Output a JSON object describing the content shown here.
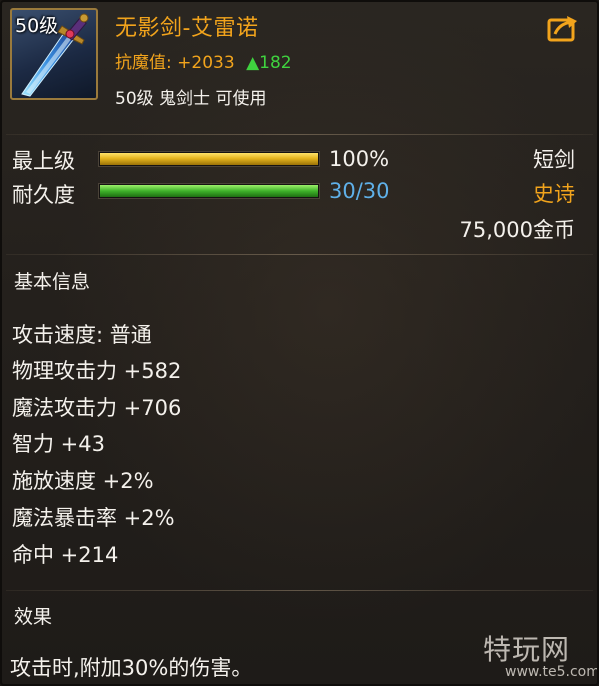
{
  "item": {
    "level_badge": "50级",
    "icon": "blue-sword-icon",
    "name": "无影剑-艾雷诺",
    "stat_label": "抗魔值:",
    "stat_value": "+2033",
    "stat_increase": "▲182",
    "requirement": "50级 鬼剑士 可使用",
    "share_icon": "share-arrow-icon"
  },
  "bars": {
    "grade": {
      "label": "最上级",
      "value_text": "100%",
      "fraction": 1.0
    },
    "durability": {
      "label": "耐久度",
      "value_text": "30/30",
      "fraction": 1.0
    }
  },
  "meta": {
    "weapon_type": "短剑",
    "rarity": "史诗",
    "price": "75,000金币"
  },
  "basic_info": {
    "title": "基本信息",
    "attributes": [
      "攻击速度: 普通",
      "物理攻击力 +582",
      "魔法攻击力 +706",
      "智力 +43",
      "施放速度 +2%",
      "魔法暴击率 +2%",
      "命中 +214"
    ]
  },
  "effect": {
    "title": "效果",
    "text": "攻击时,附加30%的伤害。"
  },
  "watermark": {
    "text": "特玩网",
    "url": "www.te5.com"
  },
  "colors": {
    "name": "#f2a41c",
    "rarity": "#f2a41c",
    "increase": "#3fd23f",
    "durability_value": "#5fb0e8",
    "gold_bar": "#e6b51e",
    "green_bar": "#3fb22a"
  }
}
